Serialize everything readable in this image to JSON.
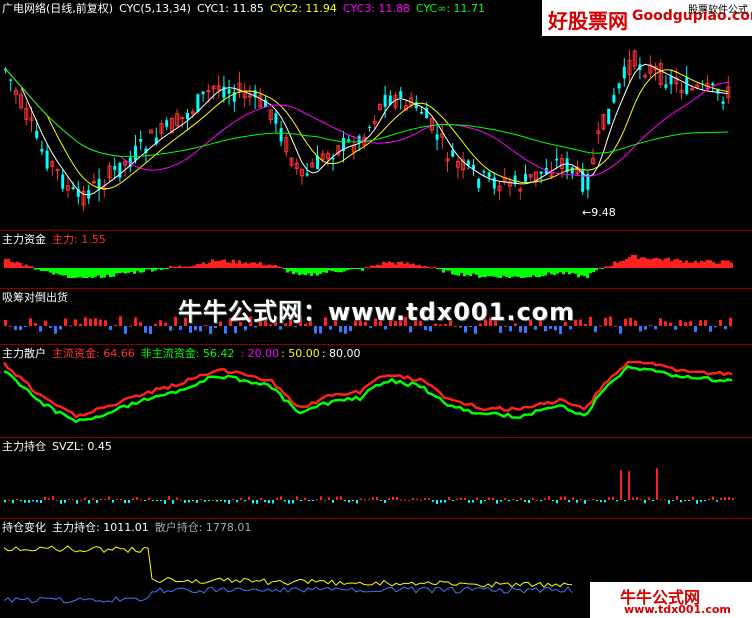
{
  "colors": {
    "up": "#ff3232",
    "down": "#00ffff",
    "ma1": "#ffffff",
    "ma2": "#ffff00",
    "ma3": "#ff00ff",
    "ma4": "#00ff00",
    "grid": "#8b0000",
    "flow_pos": "#ff2020",
    "flow_neg": "#00ff00",
    "chip_pos": "#ff2020",
    "chip_neg": "#3c78ff"
  },
  "main": {
    "title": "广电网络(日线,前复权)",
    "cyc_label": "CYC(5,13,34)",
    "cyc1": "CYC1: 11.85",
    "cyc2": "CYC2: 11.94",
    "cyc3": "CYC3: 11.88",
    "cycinf": "CYC∞: 11.71",
    "low_marker": "←9.48"
  },
  "panels": {
    "capital": {
      "title": "主力资金",
      "label": "主力: 1.55"
    },
    "chips": {
      "title": "吸筹对倒出货"
    },
    "retail": {
      "title": "主力散户",
      "main_label": "主流资金: 64.66",
      "nonmain_label": "非主流资金: 56.42",
      "l20": ": 20.00",
      "l50": ": 50.00",
      "l80": ": 80.00"
    },
    "hold": {
      "title": "主力持仓",
      "label": "SVZL: 0.45"
    },
    "change": {
      "title": "持仓变化",
      "main_label": "主力持仓: 1011.01",
      "retail_label": "散户持仓: 1778.01"
    }
  },
  "watermarks": {
    "top_brand": "好股票网",
    "top_site": "Goodgupiao.com",
    "top_sub": "股票软件公式",
    "center": "牛牛公式网：www.tdx001.com",
    "bottom_brand": "牛牛公式网",
    "bottom_site": "www.tdx001.com"
  },
  "chart_data": [
    {
      "type": "candlestick",
      "title": "广电网络(日线,前复权)",
      "series": [
        {
          "name": "CYC1",
          "values": [
            11.85
          ]
        },
        {
          "name": "CYC2",
          "values": [
            11.94
          ]
        },
        {
          "name": "CYC3",
          "values": [
            11.88
          ]
        },
        {
          "name": "CYC∞",
          "values": [
            11.71
          ]
        }
      ],
      "annotations": [
        "←9.48"
      ]
    },
    {
      "type": "bar",
      "title": "主力资金",
      "series": [
        {
          "name": "主力",
          "values": [
            1.55
          ]
        }
      ]
    },
    {
      "type": "bar",
      "title": "吸筹对倒出货"
    },
    {
      "type": "line",
      "title": "主力散户",
      "series": [
        {
          "name": "主流资金",
          "values": [
            64.66
          ]
        },
        {
          "name": "非主流资金",
          "values": [
            56.42
          ]
        }
      ],
      "reference_levels": [
        20.0,
        50.0,
        80.0
      ]
    },
    {
      "type": "bar",
      "title": "主力持仓",
      "series": [
        {
          "name": "SVZL",
          "values": [
            0.45
          ]
        }
      ]
    },
    {
      "type": "line",
      "title": "持仓变化",
      "series": [
        {
          "name": "主力持仓",
          "values": [
            1011.01
          ]
        },
        {
          "name": "散户持仓",
          "values": [
            1778.01
          ]
        }
      ]
    }
  ]
}
